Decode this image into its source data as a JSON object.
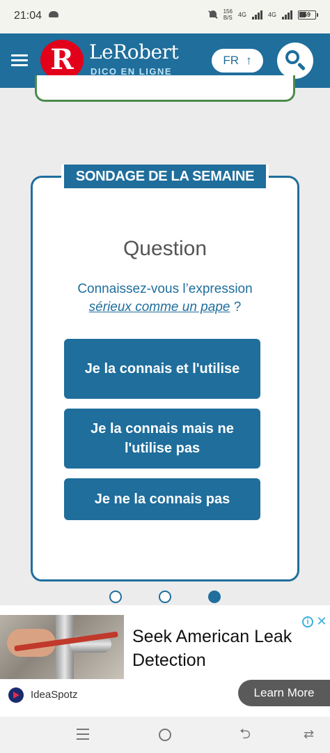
{
  "status_bar": {
    "time": "21:04",
    "speed_value": "156",
    "speed_unit": "B/S",
    "network_1": "4G",
    "network_2": "4G",
    "battery": "69"
  },
  "header": {
    "logo_letter": "R",
    "logo_name": "LeRobert",
    "logo_subtitle": "DICO EN LIGNE",
    "language": "FR",
    "language_arrow": "↑"
  },
  "poll": {
    "badge": "SONDAGE DE LA SEMAINE",
    "title": "Question",
    "question_prefix": "Connaissez-vous l’expression",
    "question_expression": "sérieux comme un pape",
    "question_suffix": " ?",
    "options": [
      "Je la connais et l'utilise",
      "Je la connais mais ne l'utilise pas",
      "Je ne la connais pas"
    ],
    "carousel_active_index": 2
  },
  "ad": {
    "headline": "Seek American Leak Detection",
    "brand": "IdeaSpotz",
    "cta": "Learn More",
    "info_glyph": "i",
    "close_glyph": "✕"
  },
  "nav": {
    "back_glyph": "⮌",
    "recent_glyph": "⇄"
  },
  "colors": {
    "brand_blue": "#1f6e9c",
    "logo_red": "#e2001a",
    "prev_card_green": "#4c8b4c"
  }
}
